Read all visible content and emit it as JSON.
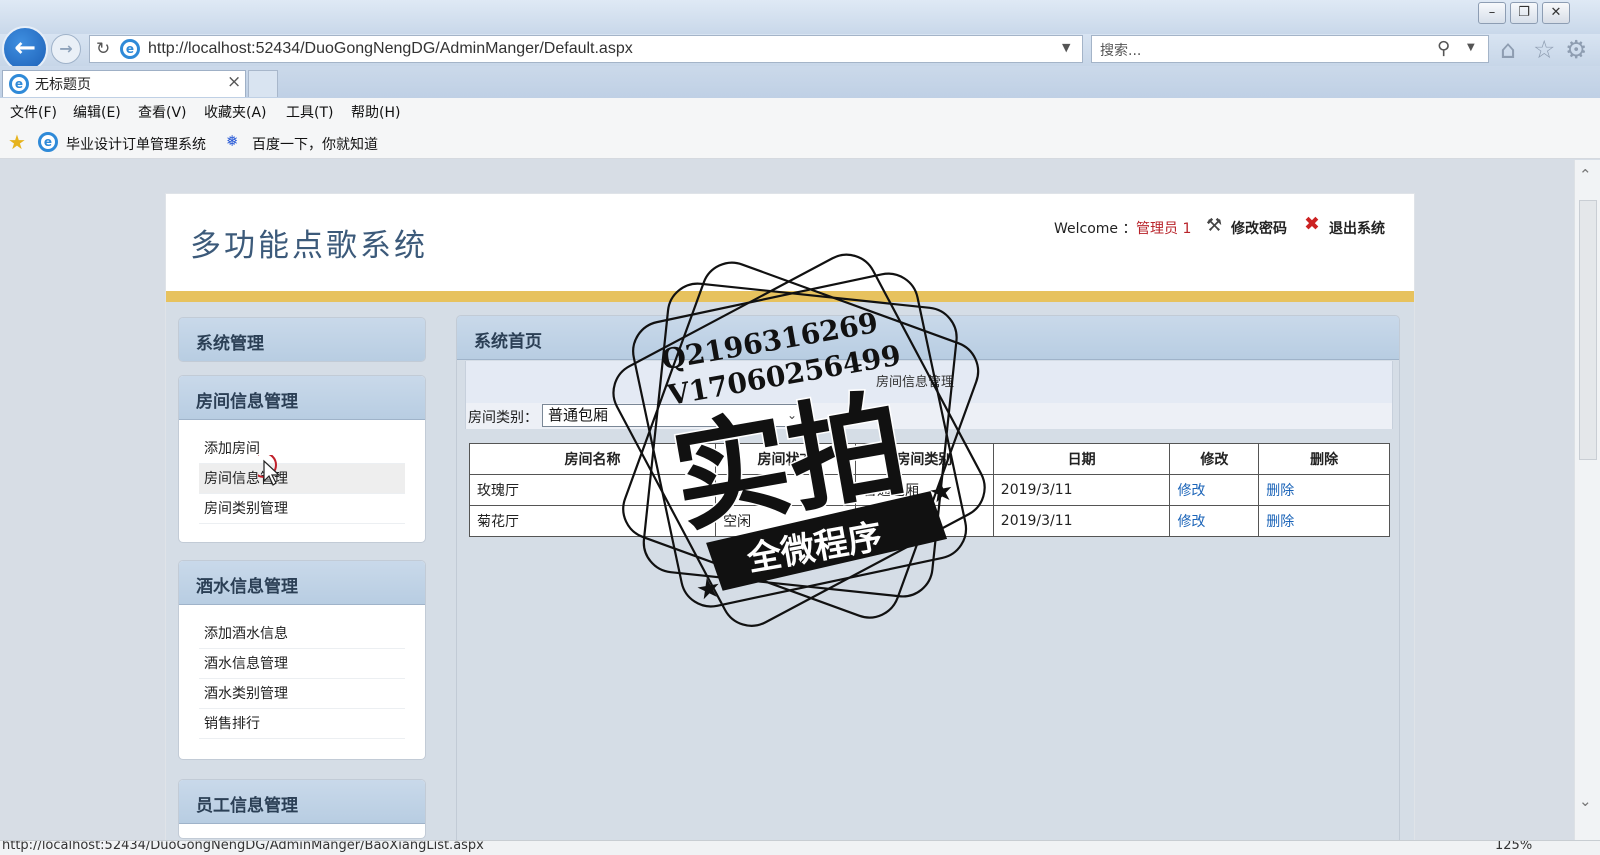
{
  "browser": {
    "url": "http://localhost:52434/DuoGongNengDG/AdminManger/Default.aspx",
    "search_placeholder": "搜索...",
    "tab_title": "无标题页",
    "window_controls": {
      "minimize": "–",
      "restore": "❐",
      "close": "✕"
    },
    "menu": [
      "文件(F)",
      "编辑(E)",
      "查看(V)",
      "收藏夹(A)",
      "工具(T)",
      "帮助(H)"
    ],
    "favorites": [
      "毕业设计订单管理系统",
      "百度一下，你就知道"
    ],
    "status_url": "http://localhost:52434/DuoGongNengDG/AdminManger/BaoXiangList.aspx",
    "zoom": "125%"
  },
  "app": {
    "title": "多功能点歌系统",
    "welcome": "Welcome ：",
    "username": "管理员 1",
    "change_password": "修改密码",
    "logout": "退出系统",
    "accent_color": "#e7c25e"
  },
  "sidebar": {
    "system": {
      "title": "系统管理"
    },
    "rooms": {
      "title": "房间信息管理",
      "items": [
        "添加房间",
        "房间信息管理",
        "房间类别管理"
      ]
    },
    "drinks": {
      "title": "酒水信息管理",
      "items": [
        "添加酒水信息",
        "酒水信息管理",
        "酒水类别管理",
        "销售排行"
      ]
    },
    "staff": {
      "title": "员工信息管理"
    }
  },
  "main": {
    "title": "系统首页",
    "breadcrumb": "房间信息管理",
    "filter_label": "房间类别：",
    "filter_value": "普通包厢",
    "table": {
      "headers": [
        "房间名称",
        "房间状态",
        "房间类别",
        "日期",
        "修改",
        "删除"
      ],
      "rows": [
        [
          "玫瑰厅",
          "空闲",
          "普通包厢",
          "2019/3/11",
          "修改",
          "删除"
        ],
        [
          "菊花厅",
          "空闲",
          "普通包厢",
          "2019/3/11",
          "修改",
          "删除"
        ]
      ]
    }
  },
  "watermark": {
    "line1": "Q2196316269",
    "line2": "V17060256499",
    "big": "实拍",
    "banner": "全微程序"
  }
}
